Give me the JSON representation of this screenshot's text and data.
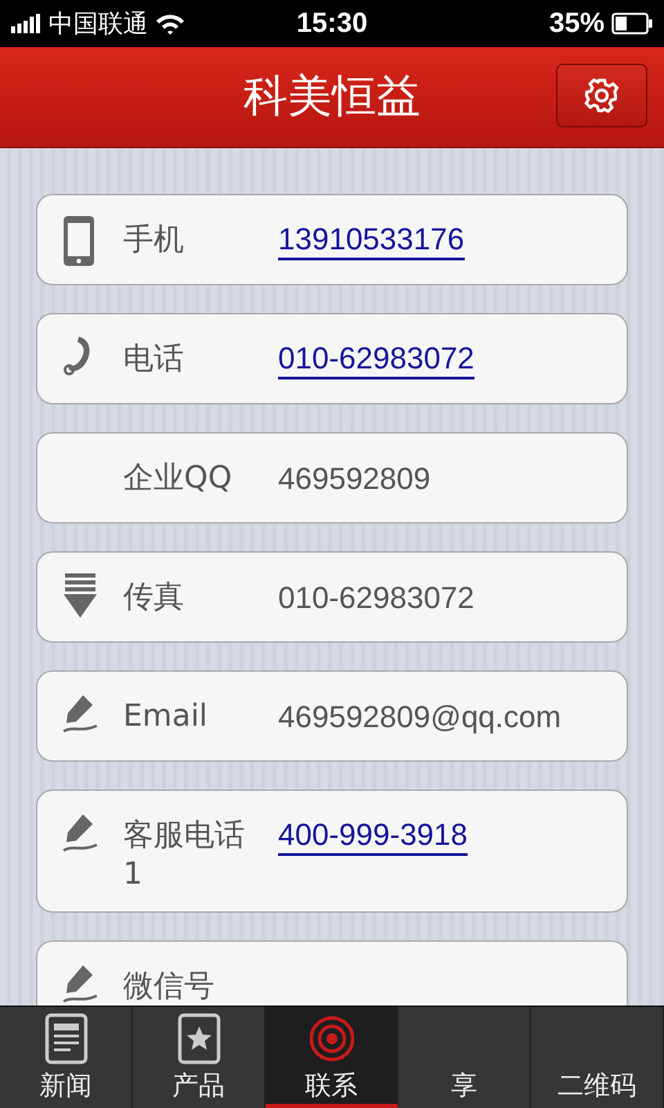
{
  "status_bar": {
    "carrier": "中国联通",
    "time": "15:30",
    "battery": "35%"
  },
  "header": {
    "title": "科美恒益"
  },
  "contacts": [
    {
      "label": "手机",
      "value": "13910533176",
      "kind": "link"
    },
    {
      "label": "电话",
      "value": "010-62983072",
      "kind": "link"
    },
    {
      "label": "企业QQ",
      "value": "469592809",
      "kind": "text"
    },
    {
      "label": "传真",
      "value": "010-62983072",
      "kind": "text"
    },
    {
      "label": "Email",
      "value": "469592809@qq.com",
      "kind": "text"
    },
    {
      "label": "客服电话1",
      "value": "400-999-3918",
      "kind": "link"
    },
    {
      "label": "微信号"
    }
  ],
  "tabs": [
    {
      "label": "新闻",
      "selected": false
    },
    {
      "label": "产品",
      "selected": false
    },
    {
      "label": "联系",
      "selected": true
    },
    {
      "label": "享",
      "selected": false
    },
    {
      "label": "二维码",
      "selected": false
    }
  ]
}
